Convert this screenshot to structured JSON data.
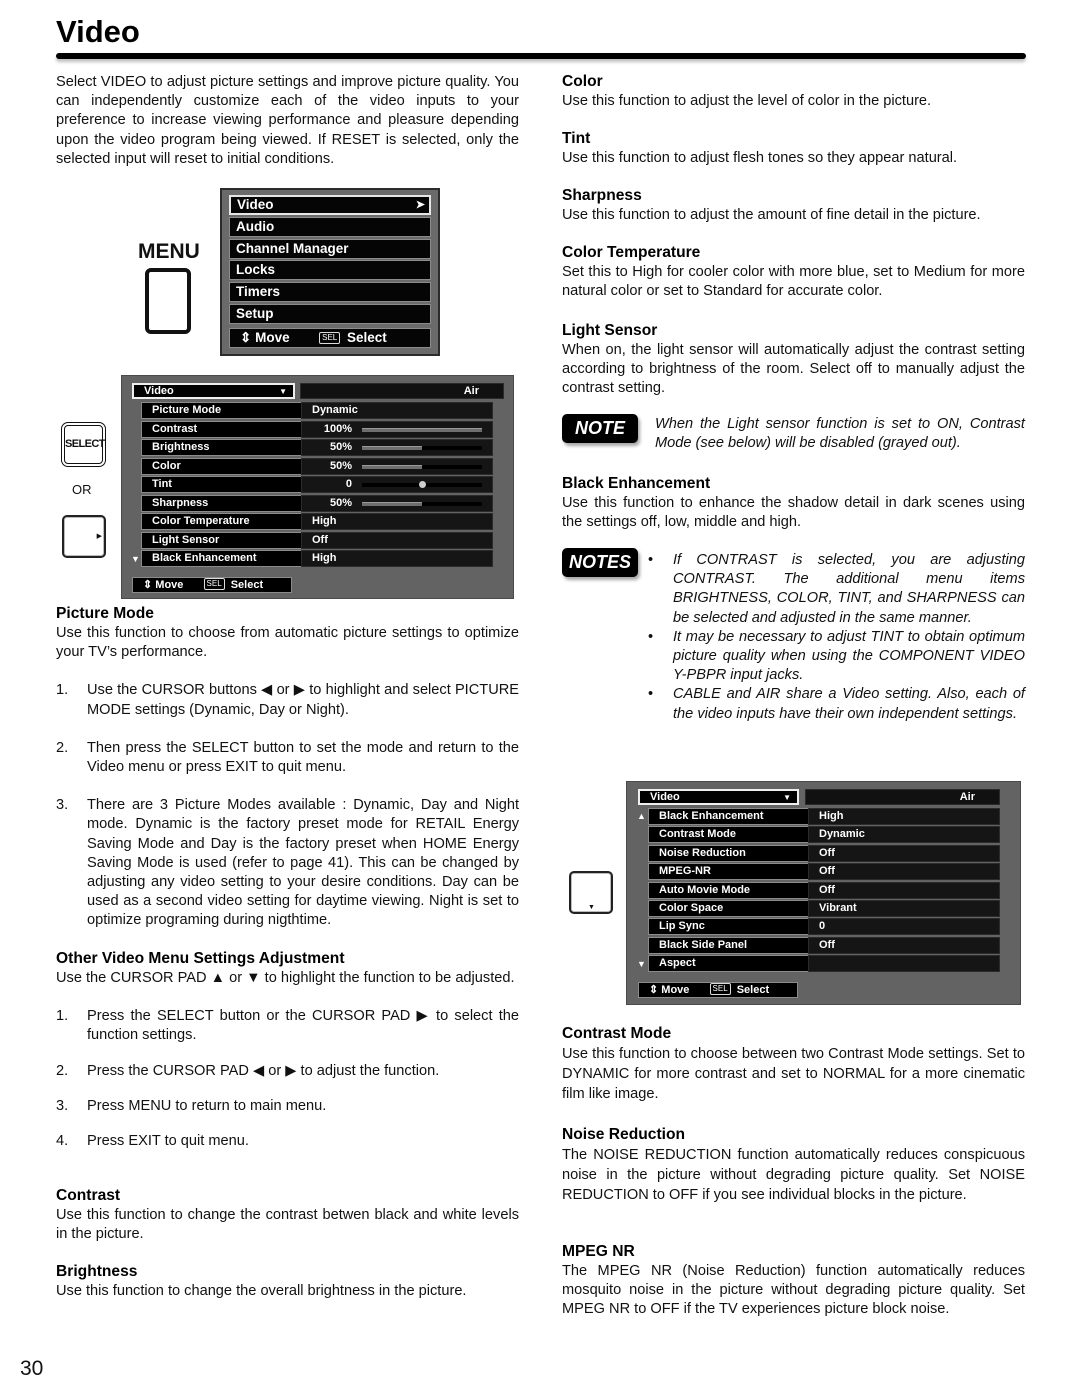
{
  "page": {
    "title": "Video",
    "number": "30"
  },
  "intro": "Select VIDEO to adjust picture settings and improve picture quality. You can independently customize each of the video inputs to your preference to increase viewing performance and pleasure depending upon the video program being viewed. If RESET is selected, only the selected input will reset to initial conditions.",
  "menu_button": {
    "label": "MENU"
  },
  "main_menu": {
    "items": [
      {
        "label": "Video",
        "arrow": "➤",
        "active": true
      },
      {
        "label": "Audio"
      },
      {
        "label": "Channel Manager"
      },
      {
        "label": "Locks"
      },
      {
        "label": "Timers"
      },
      {
        "label": "Setup"
      }
    ],
    "footer": {
      "move_icon": "⇕",
      "move_label": "Move",
      "sel_icon": "SEL",
      "select_label": "Select"
    }
  },
  "select_button": {
    "label": "SELECT"
  },
  "or_label": "OR",
  "video_menu_1": {
    "dropdown": "Video",
    "dropdown_chevron": "▼",
    "source": "Air",
    "scroll_down": "▼",
    "rows": [
      {
        "label": "Picture Mode",
        "value": "Dynamic"
      },
      {
        "label": "Contrast",
        "value": "100%",
        "level": 1.0
      },
      {
        "label": "Brightness",
        "value": "50%",
        "level": 0.5
      },
      {
        "label": "Color",
        "value": "50%",
        "level": 0.5
      },
      {
        "label": "Tint",
        "value": "0",
        "center_knob": 0.5
      },
      {
        "label": "Sharpness",
        "value": "50%",
        "level": 0.5
      },
      {
        "label": "Color Temperature",
        "value": "High"
      },
      {
        "label": "Light Sensor",
        "value": "Off"
      },
      {
        "label": "Black Enhancement",
        "value": "High"
      }
    ],
    "footer": {
      "move_icon": "⇕",
      "move_label": "Move",
      "sel_icon": "SEL",
      "select_label": "Select"
    }
  },
  "video_menu_2": {
    "dropdown": "Video",
    "dropdown_chevron": "▼",
    "source": "Air",
    "scroll_up": "▲",
    "scroll_down": "▼",
    "rows": [
      {
        "label": "Black Enhancement",
        "value": "High"
      },
      {
        "label": "Contrast Mode",
        "value": "Dynamic"
      },
      {
        "label": "Noise Reduction",
        "value": "Off"
      },
      {
        "label": "MPEG-NR",
        "value": "Off"
      },
      {
        "label": "Auto Movie Mode",
        "value": "Off"
      },
      {
        "label": "Color Space",
        "value": "Vibrant"
      },
      {
        "label": "Lip Sync",
        "value": "0"
      },
      {
        "label": "Black Side Panel",
        "value": "Off"
      },
      {
        "label": "Aspect",
        "value": ""
      }
    ],
    "footer": {
      "move_icon": "⇕",
      "move_label": "Move",
      "sel_icon": "SEL",
      "select_label": "Select"
    }
  },
  "left_sections": {
    "picture_mode": {
      "heading": "Picture Mode",
      "body": "Use this function to choose from automatic picture settings to optimize your TV’s performance.",
      "steps": [
        {
          "num": "1.",
          "text": "Use the CURSOR buttons ◀ or ▶ to highlight and select PICTURE MODE settings (Dynamic, Day or Night)."
        },
        {
          "num": "2.",
          "text": "Then press the SELECT button to set the mode and return to the Video menu or press EXIT to quit menu."
        },
        {
          "num": "3.",
          "text": "There are 3 Picture Modes available : Dynamic, Day and Night mode. Dynamic is the factory preset mode for RETAIL Energy Saving Mode and Day is the factory preset when HOME Energy Saving Mode is used (refer to page 41). This can be changed by adjusting any video setting to your desire conditions. Day can be used as a second video setting for daytime viewing. Night is set to optimize programing during nigthtime."
        }
      ]
    },
    "other": {
      "heading": "Other Video Menu Settings Adjustment",
      "body": "Use the CURSOR PAD ▲ or ▼ to highlight the function to be adjusted.",
      "steps": [
        {
          "num": "1.",
          "text": "Press the SELECT button or the CURSOR PAD ▶ to select the function settings."
        },
        {
          "num": "2.",
          "text": "Press the CURSOR PAD ◀ or ▶ to adjust the function."
        },
        {
          "num": "3.",
          "text": "Press MENU to return to main menu."
        },
        {
          "num": "4.",
          "text": "Press EXIT to quit menu."
        }
      ]
    },
    "contrast": {
      "heading": "Contrast",
      "body": "Use this function to change the contrast betwen black and white levels in the picture."
    },
    "brightness": {
      "heading": "Brightness",
      "body": "Use this function to change the overall brightness in the picture."
    }
  },
  "right_sections": {
    "color": {
      "heading": "Color",
      "body": "Use this function to adjust the level of color in the picture."
    },
    "tint": {
      "heading": "Tint",
      "body": "Use this function to adjust flesh tones so they appear natural."
    },
    "sharpness": {
      "heading": "Sharpness",
      "body": "Use this function to adjust the amount of fine detail in the picture."
    },
    "color_temperature": {
      "heading": "Color Temperature",
      "body": "Set this to High for cooler color with more blue, set to Medium for more natural color or set to Standard for accurate color."
    },
    "light_sensor": {
      "heading": "Light Sensor",
      "body": "When on, the light sensor will automatically adjust the contrast setting according to brightness of the room. Select off to manually adjust the contrast setting."
    },
    "note": {
      "badge": "NOTE",
      "text": "When the Light sensor function is set to ON, Contrast Mode (see below) will be disabled (grayed out)."
    },
    "black_enhancement": {
      "heading": "Black Enhancement",
      "body": "Use this function to enhance the shadow detail in dark scenes using the settings off, low, middle and high."
    },
    "notes": {
      "badge": "NOTES",
      "bullet": "•",
      "items": [
        "If CONTRAST is selected, you are adjusting CONTRAST. The additional menu items BRIGHTNESS, COLOR, TINT, and SHARPNESS can be selected and adjusted in the same manner.",
        "It may be necessary to adjust TINT to obtain optimum picture quality when using the COMPONENT VIDEO Y-PBPR input jacks.",
        "CABLE and AIR share a Video setting. Also, each of the video inputs have their own independent settings."
      ]
    },
    "contrast_mode": {
      "heading": "Contrast Mode",
      "body": "Use this function to choose between two Contrast Mode settings. Set to DYNAMIC for more contrast and set to NORMAL for a more cinematic film like image."
    },
    "noise_reduction": {
      "heading": "Noise Reduction",
      "body": "The NOISE REDUCTION function automatically reduces conspicuous noise in the picture without degrading picture quality. Set NOISE REDUCTION to OFF if you see individual blocks in the picture."
    },
    "mpeg_nr": {
      "heading": "MPEG NR",
      "body": "The MPEG NR (Noise Reduction) function automatically reduces mosquito noise in the picture without degrading picture quality. Set MPEG NR to OFF if the TV experiences picture block noise."
    }
  },
  "cursor_icons": {
    "right": "▶",
    "down": "▼"
  }
}
